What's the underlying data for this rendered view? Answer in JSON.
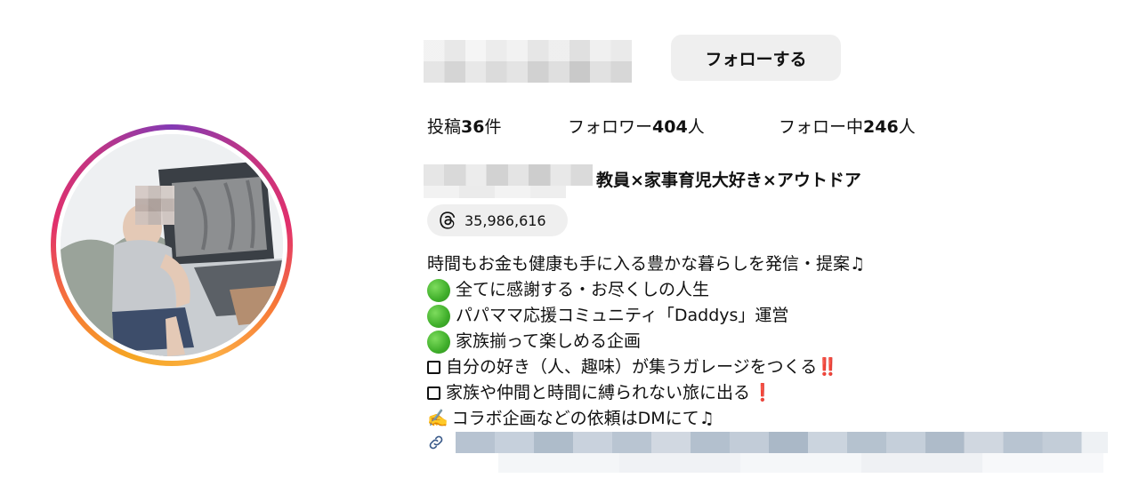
{
  "profile": {
    "follow_label": "フォローする",
    "stats": [
      {
        "label_pre": "投稿",
        "num": "36",
        "label_post": "件"
      },
      {
        "label_pre": "フォロワー",
        "num": "404",
        "label_post": "人"
      },
      {
        "label_pre": "フォロー中",
        "num": "246",
        "label_post": "人"
      }
    ],
    "bio_title": "教員×家事育児大好き×アウトドア",
    "threads_count": "35,986,616",
    "bio_lines": [
      "時間もお金も健康も手に入る豊かな暮らしを発信・提案♫",
      "全てに感謝する・お尽くしの人生",
      "パパママ応援コミュニティ「Daddys」運営",
      "家族揃って楽しめる企画",
      " 自分の好き（人、趣味）が集うガレージをつくる",
      "家族や仲間と時間に縛られない旅に出る",
      "コラボ企画などの依頼はDMにて♫"
    ],
    "marks": {
      "double_exclamation": "‼️",
      "exclamation": "❗",
      "writing_hand": "✍️"
    }
  },
  "icons": [
    "threads-icon",
    "link-icon",
    "green-circle-icon",
    "checkbox-icon"
  ],
  "colors": {
    "button_bg": "#efefef",
    "ring_start": "#f5a623",
    "ring_mid": "#e1306c",
    "ring_end": "#833ab4",
    "green_dot": "#3fae2a",
    "red_mark": "#d0021b"
  }
}
